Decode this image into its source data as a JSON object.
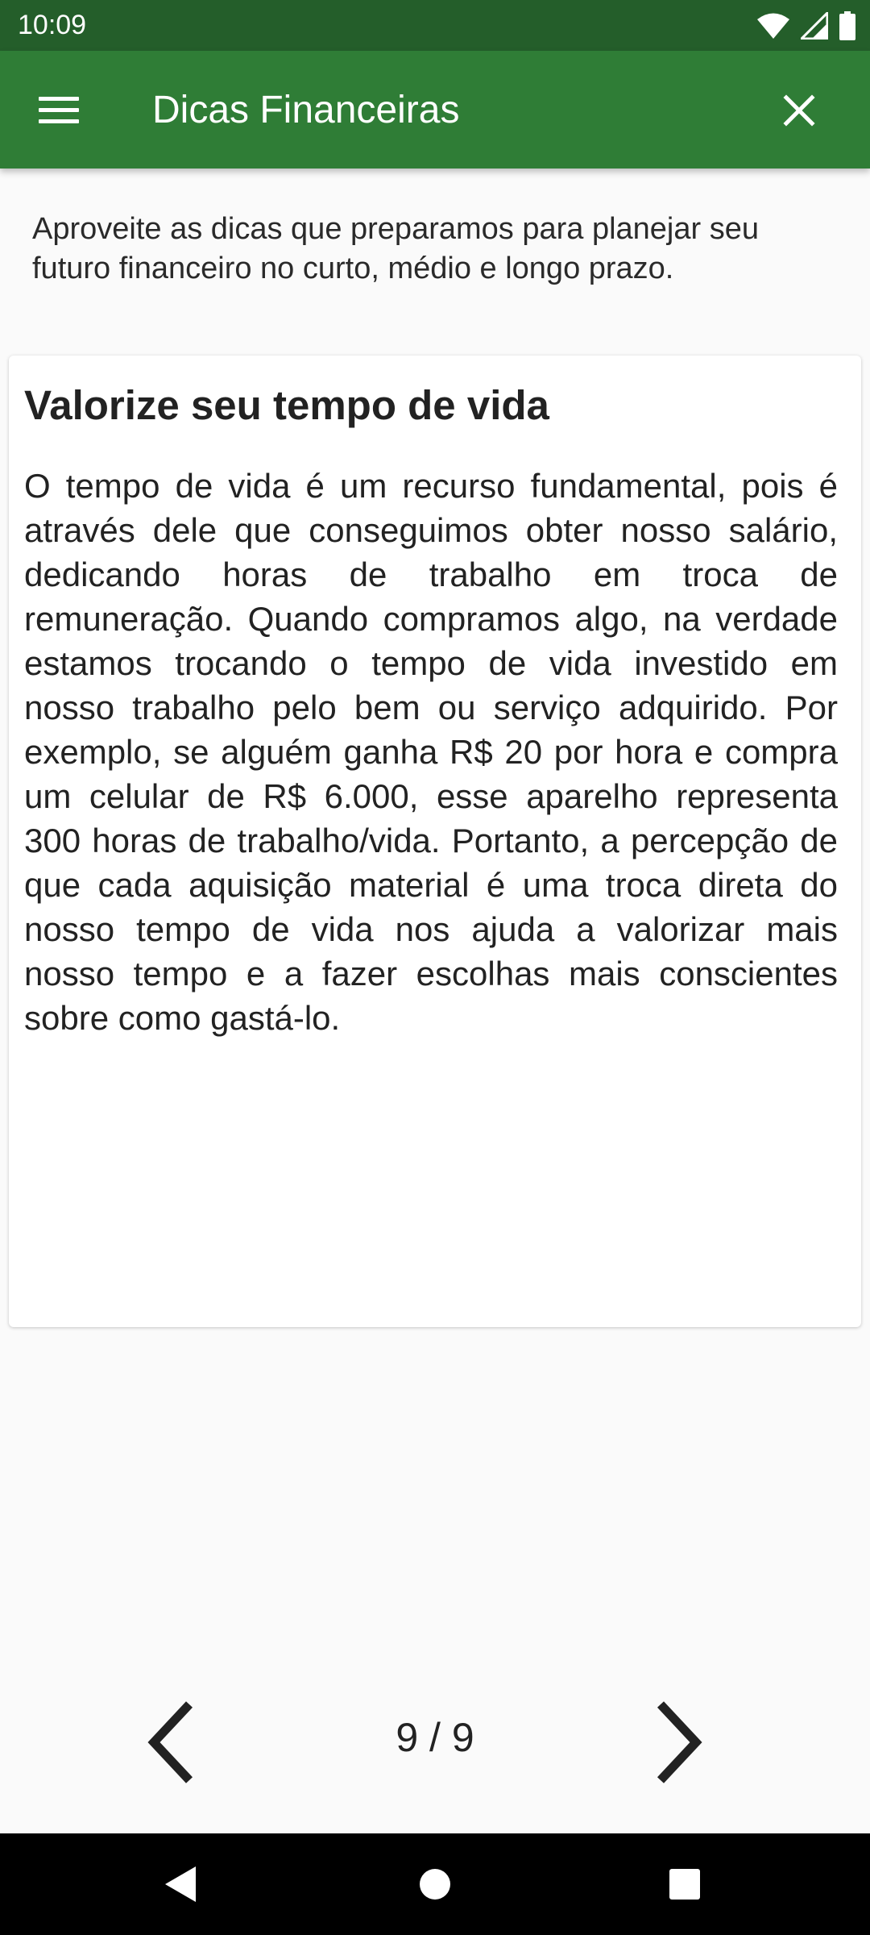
{
  "status_bar": {
    "time": "10:09"
  },
  "app_bar": {
    "title": "Dicas Financeiras"
  },
  "intro": "Aproveite as dicas que preparamos para planejar seu futuro financeiro no curto, médio e longo prazo.",
  "tip": {
    "title": "Valorize seu tempo de vida",
    "body": "O tempo de vida é um recurso fundamental, pois é através dele que conseguimos obter nosso salário, dedicando horas de trabalho em troca de remuneração. Quando compramos algo, na verdade estamos trocando o tempo de vida investido em nosso trabalho pelo bem ou serviço adquirido. Por exemplo, se alguém ganha R$ 20 por hora e compra um celular de R$ 6.000, esse aparelho representa 300 horas de trabalho/vida. Portanto, a percepção de que cada aquisição material é uma troca direta do nosso tempo de vida nos ajuda a valorizar mais nosso tempo e a fazer escolhas mais conscientes sobre como gastá-lo."
  },
  "pager": {
    "indicator": "9 / 9"
  },
  "icons": {
    "menu": "menu-icon",
    "close": "close-icon",
    "prev": "chevron-left-icon",
    "next": "chevron-right-icon",
    "wifi": "wifi-icon",
    "signal": "signal-icon",
    "battery": "battery-icon",
    "back": "back-icon",
    "home": "home-icon",
    "recents": "recents-icon"
  },
  "colors": {
    "status_bar": "#245e2a",
    "app_bar": "#2f7d36",
    "background": "#fafafa"
  }
}
